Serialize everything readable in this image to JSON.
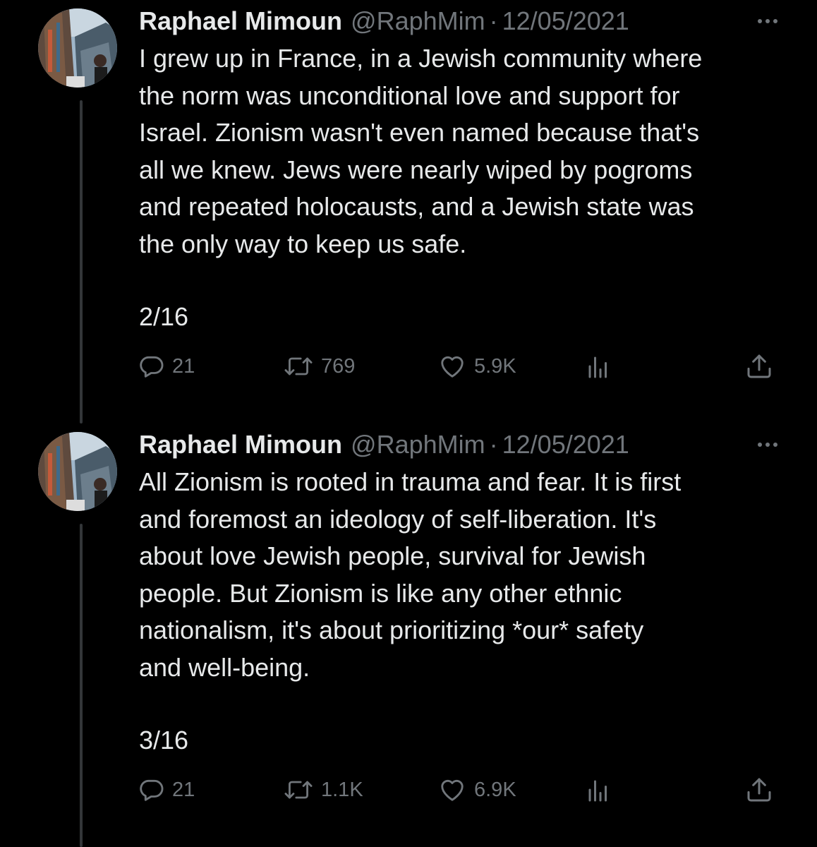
{
  "tweets": [
    {
      "author_name": "Raphael Mimoun",
      "handle": "@RaphMim",
      "separator": "·",
      "date": "12/05/2021",
      "text_lines": [
        "I grew up in France, in a Jewish community where",
        "the norm was unconditional love and support for",
        "Israel. Zionism wasn't even named because that's",
        "all we knew. Jews were nearly wiped by pogroms",
        "and repeated holocausts, and a Jewish state was",
        "the only way to keep us safe."
      ],
      "counter": "2/16",
      "replies": "21",
      "retweets": "769",
      "likes": "5.9K"
    },
    {
      "author_name": "Raphael Mimoun",
      "handle": "@RaphMim",
      "separator": "·",
      "date": "12/05/2021",
      "text_lines": [
        "All Zionism is rooted in trauma and fear. It is first",
        "and foremost an ideology of self-liberation. It's",
        "about love Jewish people, survival for Jewish",
        "people. But Zionism is like any other ethnic",
        "nationalism, it's about prioritizing *our* safety",
        "and well-being."
      ],
      "counter": "3/16",
      "replies": "21",
      "retweets": "1.1K",
      "likes": "6.9K"
    }
  ],
  "icons": {
    "reply": "reply-icon",
    "retweet": "retweet-icon",
    "like": "heart-icon",
    "views": "views-icon",
    "share": "share-icon",
    "more": "more-icon"
  },
  "colors": {
    "background": "#000000",
    "text": "#e7e9ea",
    "secondary": "#71767b",
    "thread_line": "#333639"
  }
}
